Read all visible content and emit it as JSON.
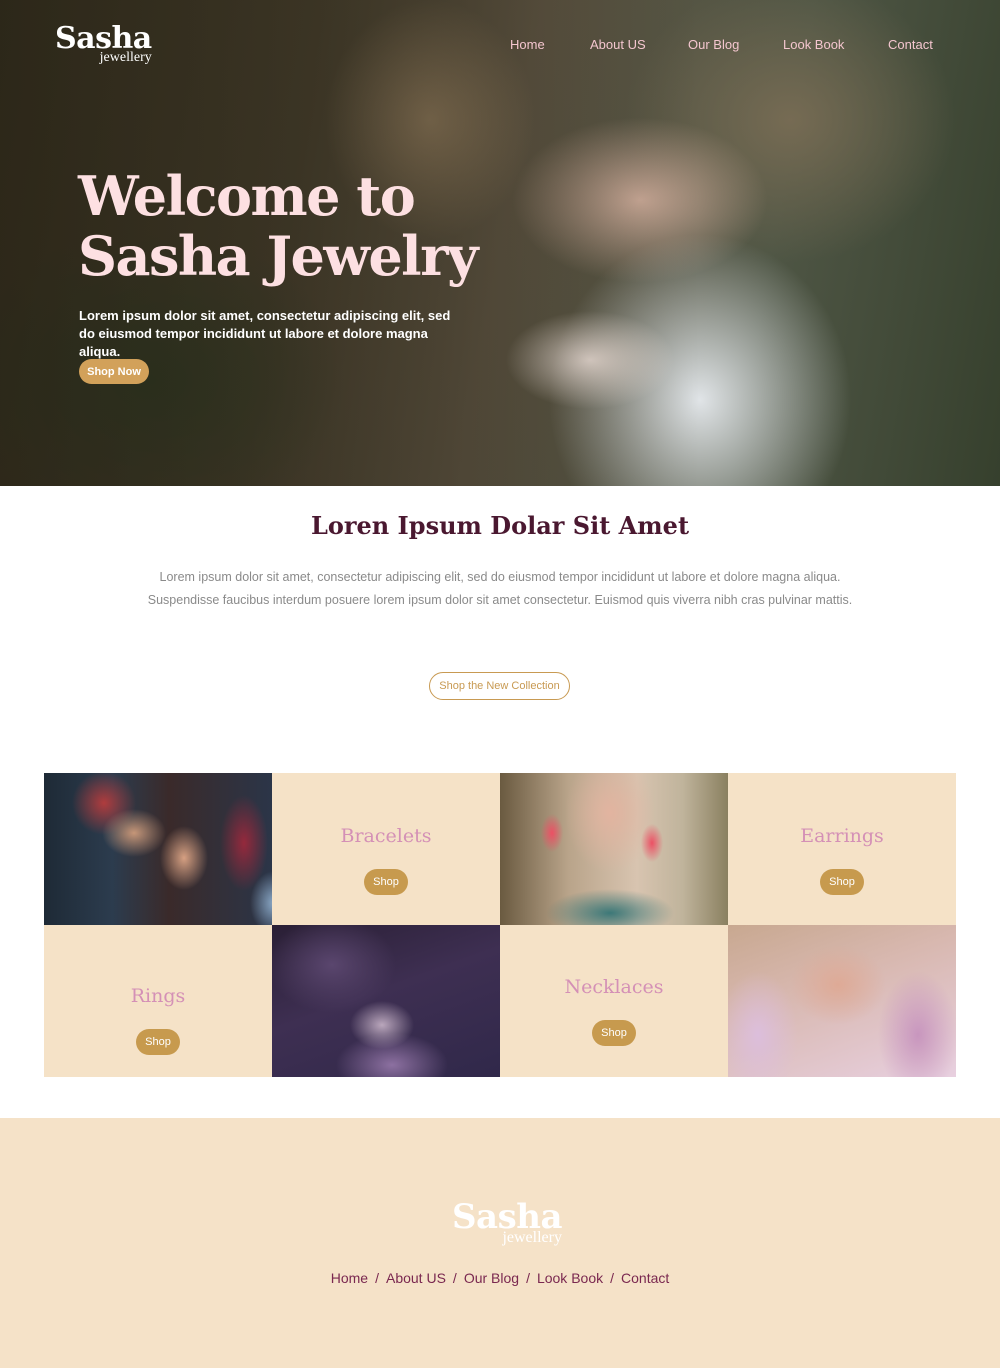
{
  "brand": {
    "name": "Sasha",
    "tagline": "jewellery"
  },
  "nav": [
    {
      "label": "Home"
    },
    {
      "label": "About US"
    },
    {
      "label": "Our Blog"
    },
    {
      "label": "Look Book"
    },
    {
      "label": "Contact"
    }
  ],
  "hero": {
    "title_line1": "Welcome to",
    "title_line2": "Sasha Jewelry",
    "text": "Lorem ipsum dolor sit amet, consectetur adipiscing elit, sed do eiusmod tempor incididunt ut labore et dolore magna aliqua.",
    "button": "Shop Now"
  },
  "intro": {
    "title": "Loren Ipsum Dolar Sit Amet",
    "text": "Lorem ipsum dolor sit amet, consectetur adipiscing elit, sed do eiusmod tempor incididunt ut labore et dolore magna aliqua. Suspendisse faucibus interdum posuere lorem ipsum dolor sit amet consectetur. Euismod quis viverra nibh cras pulvinar mattis.",
    "button": "Shop the New Collection"
  },
  "categories": [
    {
      "label": "Bracelets",
      "button": "Shop"
    },
    {
      "label": "Earrings",
      "button": "Shop"
    },
    {
      "label": "Rings",
      "button": "Shop"
    },
    {
      "label": "Necklaces",
      "button": "Shop"
    }
  ],
  "footer": {
    "nav": [
      "Home",
      "About US",
      "Our Blog",
      "Look Book",
      "Contact"
    ],
    "separator": "/"
  },
  "colors": {
    "accent_gold": "#c79a4e",
    "cream": "#f5e2c7",
    "nav_pink": "#f4c6cf",
    "heading_plum": "#4a1830",
    "category_pink": "#d490b6"
  }
}
